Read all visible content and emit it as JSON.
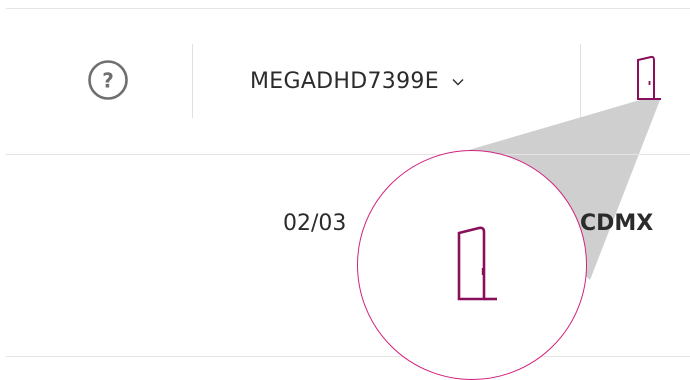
{
  "header": {
    "help_icon": "question-circle-icon",
    "help_glyph": "?",
    "account_label": "MEGADHD7399E",
    "account_chevron_icon": "chevron-down-icon",
    "logout_icon": "door-exit-icon"
  },
  "row": {
    "date_partial": "02/03",
    "city": "CDMX"
  },
  "magnifier": {
    "icon": "door-exit-icon"
  },
  "colors": {
    "accent": "#8a0f5a",
    "magnifier_ring": "#d1237d",
    "text": "#2b2b2b",
    "help_icon": "#6f6f6f",
    "divider": "#e4e4e4",
    "zoom_beam": "#cfcfcf"
  }
}
